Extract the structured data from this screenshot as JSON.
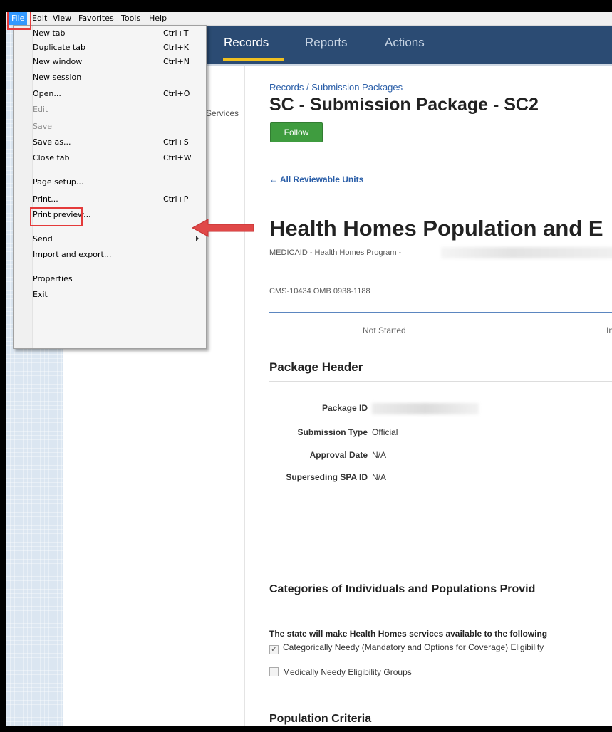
{
  "menubar": {
    "items": [
      "File",
      "Edit",
      "View",
      "Favorites",
      "Tools",
      "Help"
    ]
  },
  "nav": {
    "tabs": [
      "Records",
      "Reports",
      "Actions"
    ]
  },
  "left_pane": {
    "services_text": "Services"
  },
  "page": {
    "breadcrumb": "Records / Submission Packages",
    "package_title": "SC - Submission Package - SC2",
    "follow_label": "Follow",
    "back_link": "← All Reviewable Units",
    "title": "Health Homes Population and E",
    "subline": "MEDICAID - Health Homes Program -",
    "cms": "CMS-10434 OMB 0938-1188",
    "progress": {
      "not_started": "Not Started",
      "in": "In"
    },
    "package_header": {
      "title": "Package Header",
      "rows": [
        {
          "label": "Package ID",
          "value": ""
        },
        {
          "label": "Submission Type",
          "value": "Official"
        },
        {
          "label": "Approval Date",
          "value": "N/A"
        },
        {
          "label": "Superseding SPA ID",
          "value": "N/A"
        }
      ]
    },
    "categories": {
      "title": "Categories of Individuals and Populations Provid",
      "description": "The state will make Health Homes services available to the following",
      "options": [
        {
          "label": "Categorically Needy (Mandatory and Options for Coverage) Eligibility",
          "checked": true
        },
        {
          "label": "Medically Needy Eligibility Groups",
          "checked": false
        }
      ]
    },
    "population_criteria_title": "Population Criteria"
  },
  "file_menu": {
    "items": [
      {
        "label": "New tab",
        "shortcut": "Ctrl+T"
      },
      {
        "label": "Duplicate tab",
        "shortcut": "Ctrl+K"
      },
      {
        "label": "New window",
        "shortcut": "Ctrl+N"
      },
      {
        "label": "New session",
        "shortcut": ""
      },
      {
        "label": "Open...",
        "shortcut": "Ctrl+O"
      },
      {
        "label": "Edit",
        "shortcut": ""
      },
      {
        "label": "Save",
        "shortcut": ""
      },
      {
        "label": "Save as...",
        "shortcut": "Ctrl+S"
      },
      {
        "label": "Close tab",
        "shortcut": "Ctrl+W"
      },
      {
        "label": "Page setup...",
        "shortcut": ""
      },
      {
        "label": "Print...",
        "shortcut": "Ctrl+P"
      },
      {
        "label": "Print preview...",
        "shortcut": ""
      },
      {
        "label": "Send",
        "shortcut": ""
      },
      {
        "label": "Import and export...",
        "shortcut": ""
      },
      {
        "label": "Properties",
        "shortcut": ""
      },
      {
        "label": "Exit",
        "shortcut": ""
      }
    ]
  },
  "colors": {
    "highlight": "#e43a3a",
    "nav_bg": "#2b4b73",
    "nav_underline": "#f0c020",
    "follow_green": "#3f9c3f",
    "menu_active": "#3399ff"
  }
}
